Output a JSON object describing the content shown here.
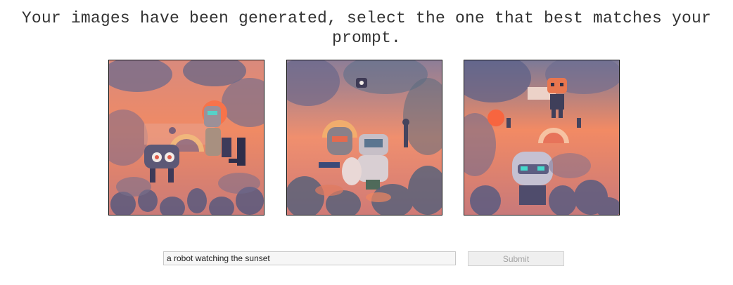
{
  "header": {
    "line1": "Your images have been generated, select the one that best matches your",
    "line2": "prompt."
  },
  "gallery": {
    "images": [
      {
        "name": "generated-image-1"
      },
      {
        "name": "generated-image-2"
      },
      {
        "name": "generated-image-3"
      }
    ]
  },
  "form": {
    "prompt_value": "a robot watching the sunset",
    "submit_label": "Submit",
    "submit_disabled": true
  },
  "colors": {
    "sky": "#e98a6e",
    "sun": "#f3704f",
    "foliage": "#5f5f84",
    "robot_metal": "#c9c3d2",
    "eye_teal": "#4fd6d0",
    "text": "#333333"
  }
}
